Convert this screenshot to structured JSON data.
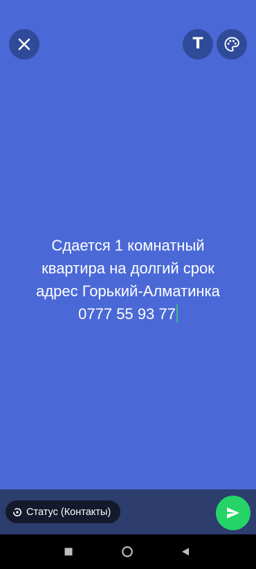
{
  "status_editor": {
    "text_lines": [
      "Сдается 1 комнатный",
      "квартира на долгий срок",
      "адрес Горький-Алматинка",
      "0777 55 93 77"
    ],
    "background_color": "#4b69d6"
  },
  "toolbar": {
    "close_icon": "close-icon",
    "text_tool_label": "T",
    "palette_icon": "palette-icon"
  },
  "footer": {
    "audience_label": "Статус (Контакты)",
    "audience_icon": "status-ring-icon",
    "send_icon": "send-icon",
    "send_color": "#25d366"
  },
  "navigation": {
    "recents_icon": "square-icon",
    "home_icon": "circle-icon",
    "back_icon": "triangle-back-icon"
  }
}
